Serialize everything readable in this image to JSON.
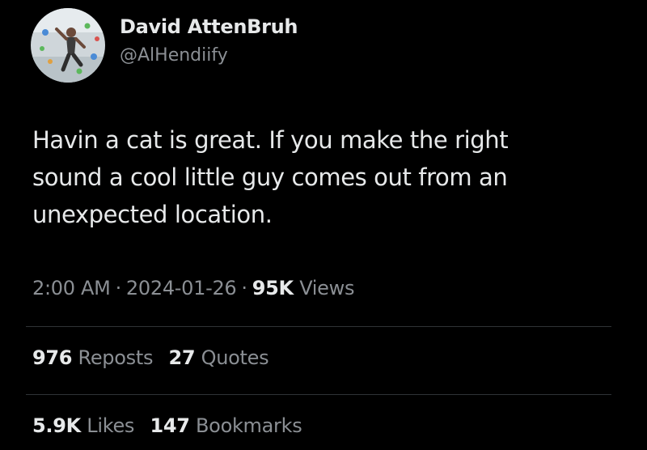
{
  "author": {
    "display_name": "David AttenBruh",
    "handle": "@AlHendiify",
    "avatar_icon": "climber-avatar-icon"
  },
  "tweet": {
    "text_lines": [
      "Havin a cat is great. If you make the right",
      "sound a cool little guy comes out from an",
      "unexpected location."
    ]
  },
  "meta": {
    "time": "2:00 AM",
    "separator": "·",
    "date": "2024-01-26",
    "views_count": "95K",
    "views_label": "Views"
  },
  "engagement": {
    "reposts_count": "976",
    "reposts_label": "Reposts",
    "quotes_count": "27",
    "quotes_label": "Quotes",
    "likes_count": "5.9K",
    "likes_label": "Likes",
    "bookmarks_count": "147",
    "bookmarks_label": "Bookmarks"
  },
  "colors": {
    "background": "#000000",
    "primary_text": "#e7e9ea",
    "secondary_text": "#8b8f94",
    "divider": "#2f3336"
  }
}
